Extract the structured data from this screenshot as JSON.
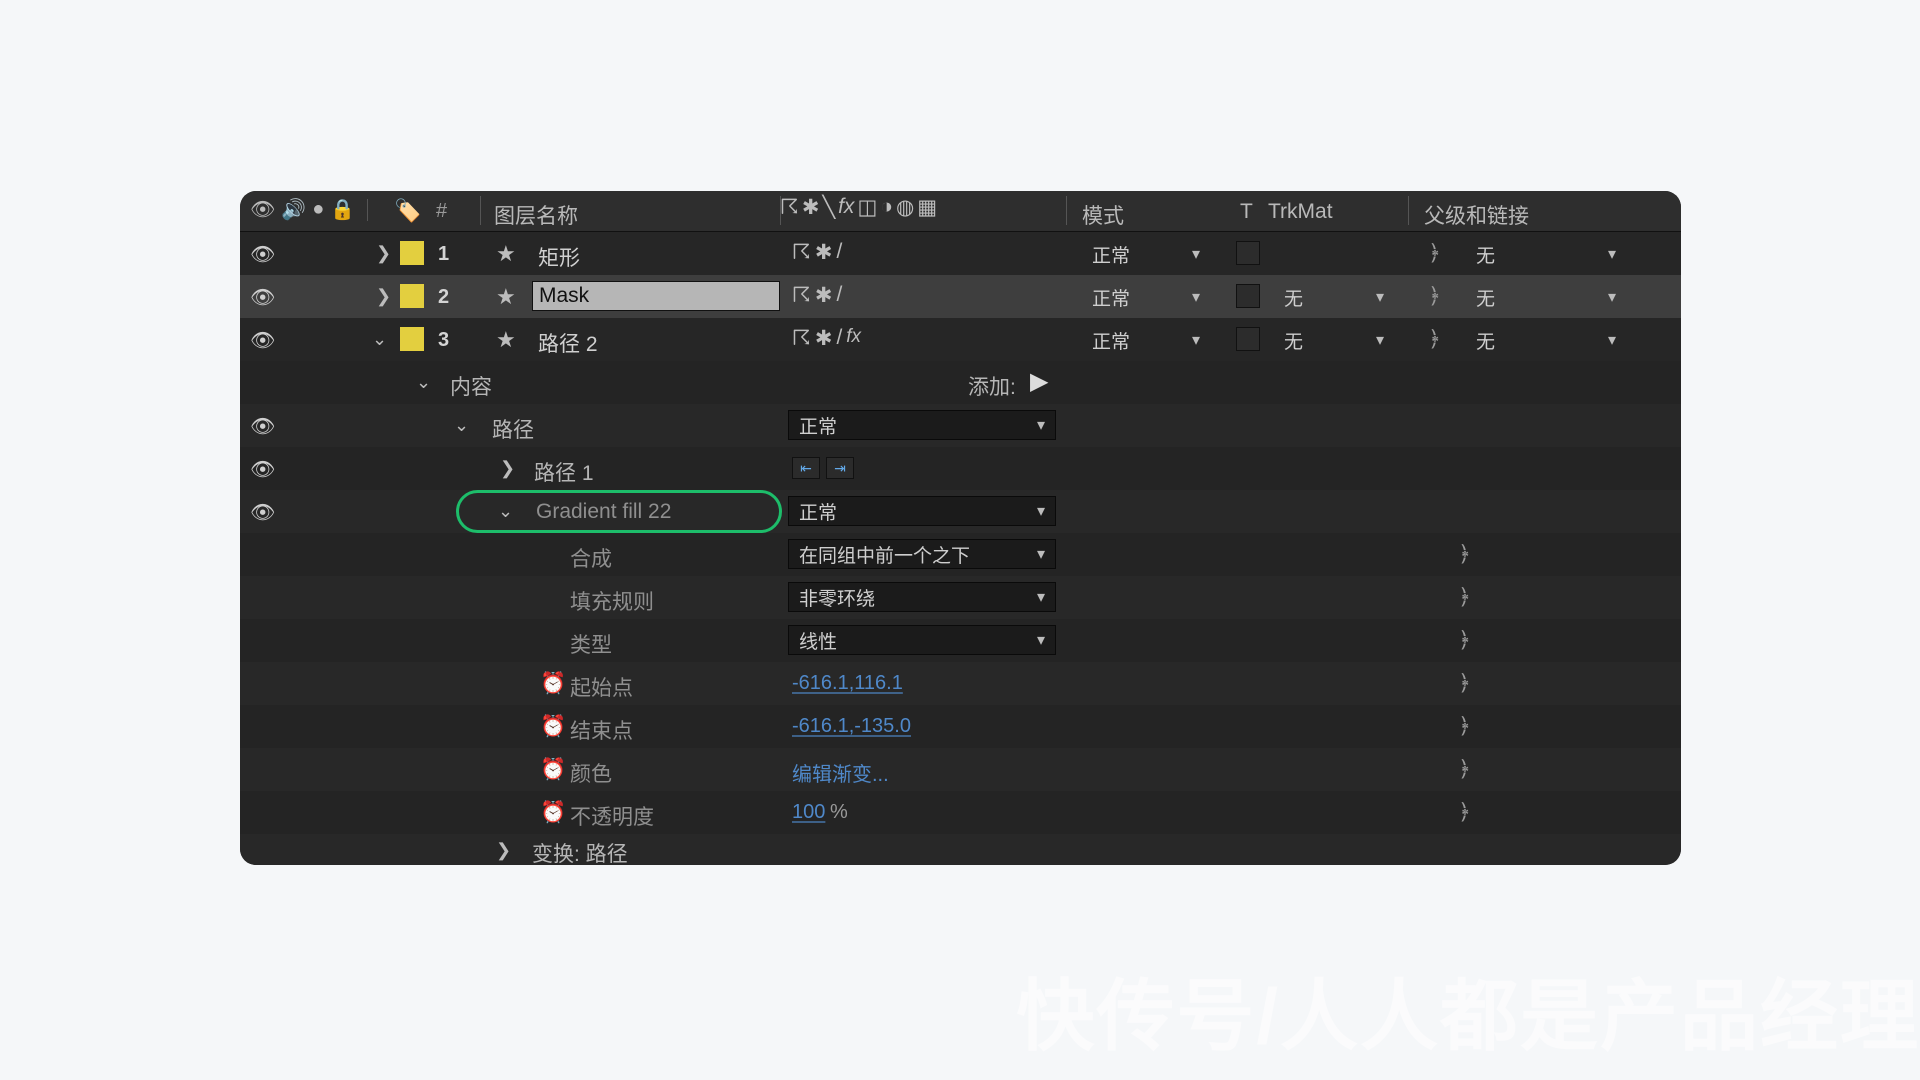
{
  "header": {
    "hash": "#",
    "layer_name_label": "图层名称",
    "mode_label": "模式",
    "t_label": "T",
    "trkmat_label": "TrkMat",
    "parent_label": "父级和链接"
  },
  "layers": [
    {
      "index": "1",
      "name": "矩形",
      "mode": "正常",
      "trkmat": "",
      "parent": "无"
    },
    {
      "index": "2",
      "name": "Mask",
      "mode": "正常",
      "trkmat": "无",
      "parent": "无"
    },
    {
      "index": "3",
      "name": "路径 2",
      "mode": "正常",
      "trkmat": "无",
      "parent": "无"
    }
  ],
  "content": {
    "label": "内容",
    "add_label": "添加:",
    "path_group": {
      "label": "路径",
      "mode": "正常",
      "path1": "路径 1"
    },
    "gradient": {
      "title": "Gradient fill 22",
      "mode": "正常",
      "composite_label": "合成",
      "composite_value": "在同组中前一个之下",
      "fillrule_label": "填充规则",
      "fillrule_value": "非零环绕",
      "type_label": "类型",
      "type_value": "线性",
      "start_label": "起始点",
      "start_value": "-616.1,116.1",
      "end_label": "结束点",
      "end_value": "-616.1,-135.0",
      "color_label": "颜色",
      "color_value": "编辑渐变...",
      "opacity_label": "不透明度",
      "opacity_value": "100",
      "opacity_unit": "%"
    },
    "transform_label": "变换: 路径"
  },
  "watermark": "快传号/人人都是产品经理"
}
